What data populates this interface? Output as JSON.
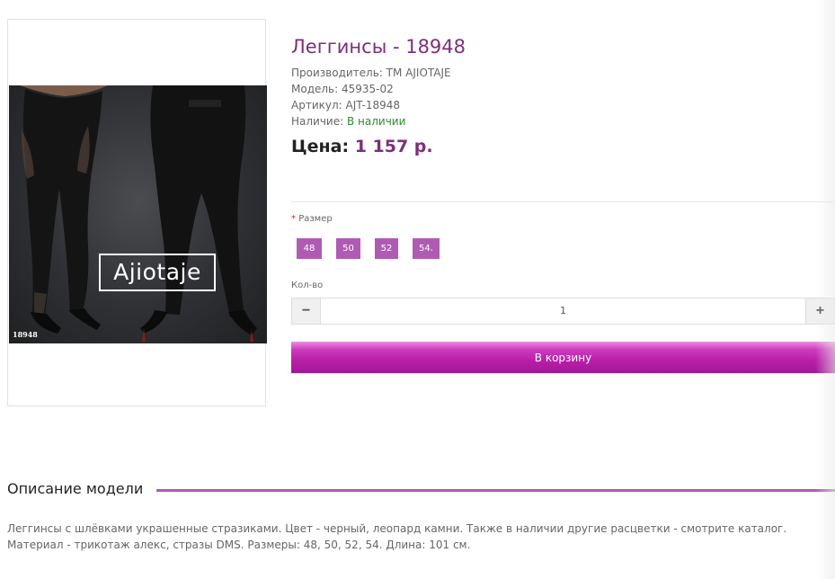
{
  "product": {
    "title": "Леггинсы - 18948",
    "manufacturer_label": "Производитель:",
    "manufacturer_value": "ТМ AJIOTAJE",
    "model_label": "Модель:",
    "model_value": "45935-02",
    "sku_label": "Артикул:",
    "sku_value": "AJT-18948",
    "availability_label": "Наличие:",
    "availability_value": "В наличии",
    "price_label": "Цена:",
    "price_value": "1 157 р."
  },
  "image": {
    "brand_text": "Ajiotaje",
    "code_text": "18948"
  },
  "options": {
    "required_mark": "*",
    "size_label": "Размер",
    "sizes": [
      "48",
      "50",
      "52",
      "54."
    ]
  },
  "quantity": {
    "label": "Кол-во",
    "value": "1",
    "minus_symbol": "−",
    "plus_symbol": "+"
  },
  "cart": {
    "button_label": "В корзину"
  },
  "description": {
    "heading": "Описание модели",
    "text": "Леггинсы с шлёвками украшенные стразиками. Цвет - черный, леопард камни. Также в наличии другие расцветки - смотрите каталог. Материал - трикотаж алекс, стразы DMS. Размеры: 48, 50, 52, 54. Длина: 101 см."
  },
  "colors": {
    "accent": "#7e2e7c",
    "size_button": "#b05bb3",
    "cart_button": "#b81fa8",
    "in_stock": "#2e8b2e"
  }
}
